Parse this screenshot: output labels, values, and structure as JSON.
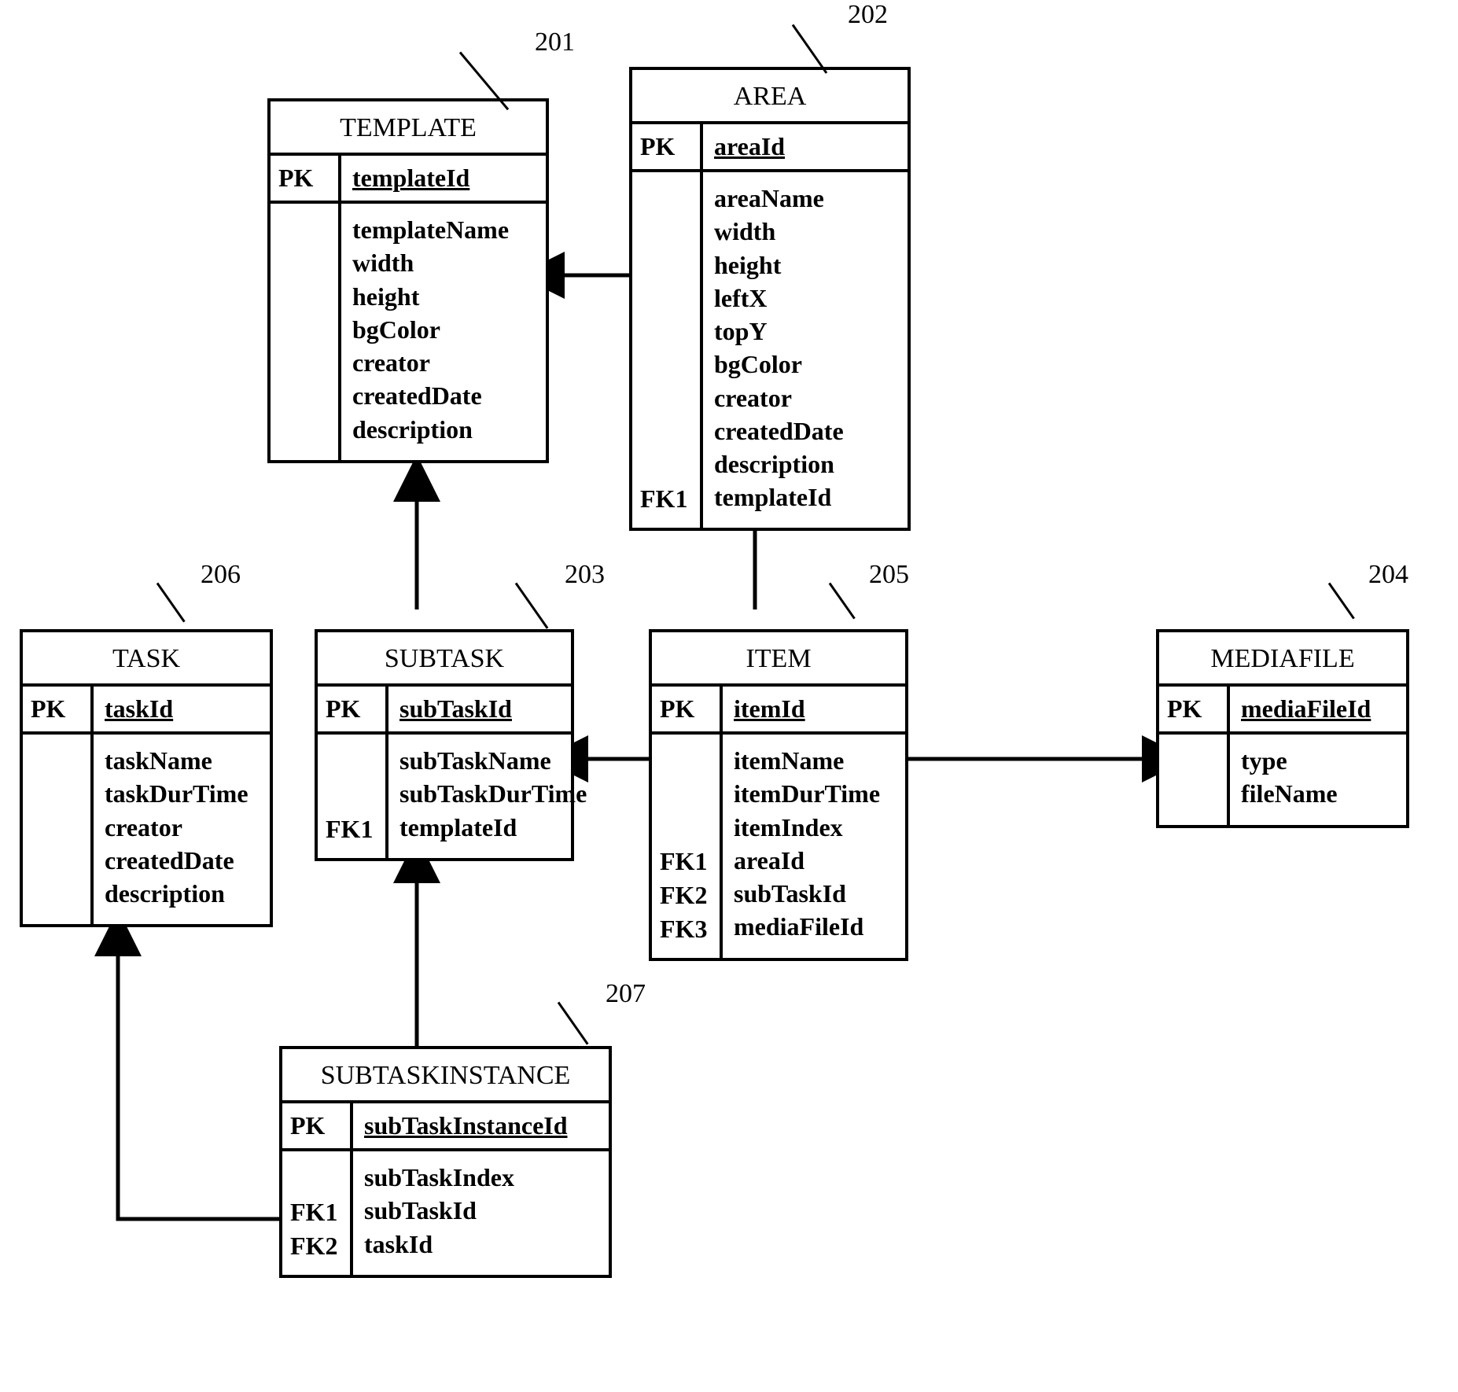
{
  "chart_data": {
    "type": "diagram",
    "diagram_type": "entity-relationship",
    "entities": [
      {
        "id": 201,
        "name": "TEMPLATE",
        "pk": "templateId",
        "attrs": [
          "templateName",
          "width",
          "height",
          "bgColor",
          "creator",
          "createdDate",
          "description"
        ],
        "fks": []
      },
      {
        "id": 202,
        "name": "AREA",
        "pk": "areaId",
        "attrs": [
          "areaName",
          "width",
          "height",
          "leftX",
          "topY",
          "bgColor",
          "creator",
          "createdDate",
          "description",
          "templateId"
        ],
        "fks": [
          "FK1"
        ]
      },
      {
        "id": 203,
        "name": "SUBTASK",
        "pk": "subTaskId",
        "attrs": [
          "subTaskName",
          "subTaskDurTime",
          "templateId"
        ],
        "fks": [
          "FK1"
        ]
      },
      {
        "id": 204,
        "name": "MEDIAFILE",
        "pk": "mediaFileId",
        "attrs": [
          "type",
          "fileName"
        ],
        "fks": []
      },
      {
        "id": 205,
        "name": "ITEM",
        "pk": "itemId",
        "attrs": [
          "itemName",
          "itemDurTime",
          "itemIndex",
          "areaId",
          "subTaskId",
          "mediaFileId"
        ],
        "fks": [
          "FK1",
          "FK2",
          "FK3"
        ]
      },
      {
        "id": 206,
        "name": "TASK",
        "pk": "taskId",
        "attrs": [
          "taskName",
          "taskDurTime",
          "creator",
          "createdDate",
          "description"
        ],
        "fks": []
      },
      {
        "id": 207,
        "name": "SUBTASKINSTANCE",
        "pk": "subTaskInstanceId",
        "attrs": [
          "subTaskIndex",
          "subTaskId",
          "taskId"
        ],
        "fks": [
          "FK1",
          "FK2"
        ]
      }
    ],
    "relationships": [
      {
        "from": "AREA",
        "to": "TEMPLATE"
      },
      {
        "from": "SUBTASK",
        "to": "TEMPLATE"
      },
      {
        "from": "ITEM",
        "to": "AREA"
      },
      {
        "from": "ITEM",
        "to": "SUBTASK"
      },
      {
        "from": "ITEM",
        "to": "MEDIAFILE"
      },
      {
        "from": "SUBTASKINSTANCE",
        "to": "SUBTASK"
      },
      {
        "from": "SUBTASKINSTANCE",
        "to": "TASK"
      }
    ]
  },
  "callouts": {
    "c201": "201",
    "c202": "202",
    "c203": "203",
    "c204": "204",
    "c205": "205",
    "c206": "206",
    "c207": "207"
  },
  "e201": {
    "title": "TEMPLATE",
    "pklabel": "PK",
    "pk": "templateId",
    "attrs": [
      "templateName",
      "width",
      "height",
      "bgColor",
      "creator",
      "createdDate",
      "description"
    ],
    "fks": []
  },
  "e202": {
    "title": "AREA",
    "pklabel": "PK",
    "pk": "areaId",
    "attrs": [
      "areaName",
      "width",
      "height",
      "leftX",
      "topY",
      "bgColor",
      "creator",
      "createdDate",
      "description",
      "templateId"
    ],
    "fks": [
      "FK1"
    ]
  },
  "e203": {
    "title": "SUBTASK",
    "pklabel": "PK",
    "pk": "subTaskId",
    "attrs": [
      "subTaskName",
      "subTaskDurTime",
      "templateId"
    ],
    "fks": [
      "FK1"
    ]
  },
  "e204": {
    "title": "MEDIAFILE",
    "pklabel": "PK",
    "pk": "mediaFileId",
    "attrs": [
      "type",
      "fileName"
    ],
    "fks": []
  },
  "e205": {
    "title": "ITEM",
    "pklabel": "PK",
    "pk": "itemId",
    "attrs": [
      "itemName",
      "itemDurTime",
      "itemIndex",
      "areaId",
      "subTaskId",
      "mediaFileId"
    ],
    "fks": [
      "FK1",
      "FK2",
      "FK3"
    ]
  },
  "e206": {
    "title": "TASK",
    "pklabel": "PK",
    "pk": "taskId",
    "attrs": [
      "taskName",
      "taskDurTime",
      "creator",
      "createdDate",
      "description"
    ],
    "fks": []
  },
  "e207": {
    "title": "SUBTASKINSTANCE",
    "pklabel": "PK",
    "pk": "subTaskInstanceId",
    "attrs": [
      "subTaskIndex",
      "subTaskId",
      "taskId"
    ],
    "fks": [
      "FK1",
      "FK2"
    ]
  }
}
